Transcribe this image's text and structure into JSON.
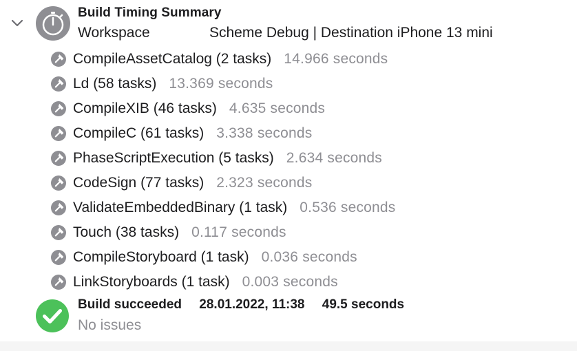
{
  "summary": {
    "title": "Build Timing Summary",
    "workspace_label": "Workspace",
    "scheme_destination": "Scheme Debug | Destination iPhone 13 mini",
    "icon": "stopwatch-icon",
    "disclosure_icon": "chevron-down-icon"
  },
  "tasks": [
    {
      "name": "CompileAssetCatalog (2 tasks)",
      "time": "14.966 seconds"
    },
    {
      "name": "Ld (58 tasks)",
      "time": "13.369 seconds"
    },
    {
      "name": "CompileXIB (46 tasks)",
      "time": "4.635 seconds"
    },
    {
      "name": "CompileC (61 tasks)",
      "time": "3.338 seconds"
    },
    {
      "name": "PhaseScriptExecution (5 tasks)",
      "time": "2.634 seconds"
    },
    {
      "name": "CodeSign (77 tasks)",
      "time": "2.323 seconds"
    },
    {
      "name": "ValidateEmbeddedBinary (1 task)",
      "time": "0.536 seconds"
    },
    {
      "name": "Touch (38 tasks)",
      "time": "0.117 seconds"
    },
    {
      "name": "CompileStoryboard (1 task)",
      "time": "0.036 seconds"
    },
    {
      "name": "LinkStoryboards (1 task)",
      "time": "0.003 seconds"
    }
  ],
  "task_icon": "hammer-icon",
  "result": {
    "status": "Build succeeded",
    "date": "28.01.2022, 11:38",
    "duration": "49.5 seconds",
    "issues": "No issues",
    "icon": "checkmark-circle-icon"
  },
  "colors": {
    "success_green": "#4cc15a",
    "icon_gray": "#8e8e93",
    "secondary_text": "#8e8e93",
    "primary_text": "#1d1d1f"
  }
}
